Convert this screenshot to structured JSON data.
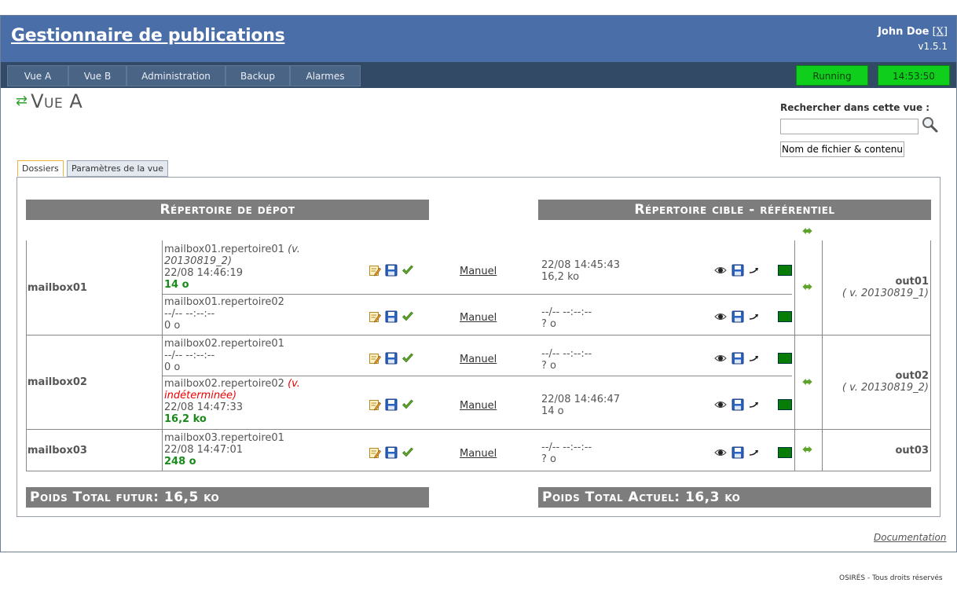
{
  "header": {
    "title": "Gestionnaire de publications",
    "user": "John Doe",
    "logout_open": "[",
    "logout_label": "X",
    "logout_close": "]",
    "version": "v1.5.1"
  },
  "nav": {
    "items": [
      "Vue A",
      "Vue B",
      "Administration",
      "Backup",
      "Alarmes"
    ],
    "status": "Running",
    "clock": "14:53:50"
  },
  "view": {
    "title": "Vue A"
  },
  "search": {
    "label": "Rechercher dans cette vue :",
    "value": "",
    "scope": "Nom de fichier & contenu"
  },
  "tabs": [
    "Dossiers",
    "Paramètres de la vue"
  ],
  "sections": {
    "depot": "Répertoire de dépot",
    "cible": "Répertoire cible - référentiel"
  },
  "rows": [
    {
      "mailbox": "mailbox01",
      "dir": "mailbox01.repertoire01",
      "version": "(v. 20130819_2)",
      "date": "22/08 14:46:19",
      "size": "14 o",
      "manual": "Manuel",
      "target_date": "22/08 14:45:43",
      "target_size": "16,2 ko"
    },
    {
      "mailbox": "",
      "dir": "mailbox01.repertoire02",
      "version": "",
      "date": "--/-- --:--:--",
      "size": "0 o",
      "manual": "Manuel",
      "target_date": "--/-- --:--:--",
      "target_size": "? o"
    },
    {
      "mailbox": "mailbox02",
      "dir": "mailbox02.repertoire01",
      "version": "",
      "date": "--/-- --:--:--",
      "size": "0 o",
      "manual": "Manuel",
      "target_date": "--/-- --:--:--",
      "target_size": "? o"
    },
    {
      "mailbox": "",
      "dir": "mailbox02.repertoire02",
      "version": "(v. indéterminée)",
      "date": "22/08 14:47:33",
      "size": "16,2 ko",
      "manual": "Manuel",
      "target_date": "22/08 14:46:47",
      "target_size": "14 o"
    },
    {
      "mailbox": "mailbox03",
      "dir": "mailbox03.repertoire01",
      "version": "",
      "date": "22/08 14:47:01",
      "size": "248 o",
      "manual": "Manuel",
      "target_date": "--/-- --:--:--",
      "target_size": "? o"
    }
  ],
  "outputs": [
    {
      "name": "out01",
      "version": "( v. 20130819_1)"
    },
    {
      "name": "out02",
      "version": "( v. 20130819_2)"
    },
    {
      "name": "out03",
      "version": ""
    }
  ],
  "totals": {
    "future": "Poids Total futur: 16,5 ko",
    "current": "Poids Total Actuel: 16,3 ko"
  },
  "footer": {
    "documentation": "Documentation",
    "copyright": "OSIRÉS - Tous droits réservés"
  },
  "colors": {
    "header_bg": "#4a6ea7",
    "nav_bg": "#324a66",
    "status_green": "#0fcf1c",
    "section_gray": "#7d7d7d",
    "ok_square": "#077c07"
  }
}
